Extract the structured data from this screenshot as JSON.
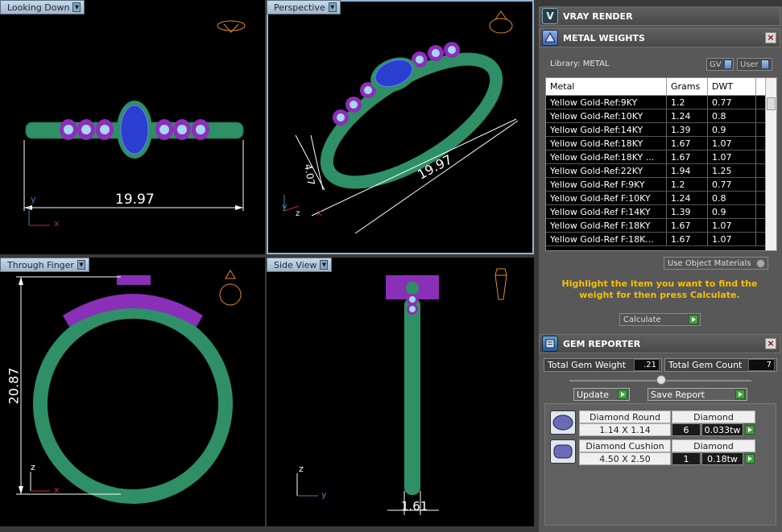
{
  "viewports": {
    "looking_down": {
      "label": "Looking Down",
      "dimension": "19.97",
      "axis_y": "y",
      "axis_x": "x"
    },
    "perspective": {
      "label": "Perspective",
      "dimension_a": "19.97",
      "dimension_b": "4.07",
      "axis_y": "y",
      "axis_z": "z",
      "axis_x": "x"
    },
    "through_finger": {
      "label": "Through Finger",
      "dimension": "20.87",
      "axis_z": "z",
      "axis_x": "x"
    },
    "side_view": {
      "label": "Side View",
      "dimension": "1.61",
      "axis_z": "z",
      "axis_y": "y"
    }
  },
  "vray_render": {
    "title": "VRAY RENDER"
  },
  "metal_weights": {
    "title": "METAL WEIGHTS",
    "library_label": "Library: METAL",
    "toggle_gv": "GV",
    "toggle_user": "User",
    "columns": [
      "Metal",
      "Grams",
      "DWT"
    ],
    "rows": [
      [
        "Yellow Gold-Ref:9KY",
        "1.2",
        "0.77"
      ],
      [
        "Yellow Gold-Ref:10KY",
        "1.24",
        "0.8"
      ],
      [
        "Yellow Gold-Ref:14KY",
        "1.39",
        "0.9"
      ],
      [
        "Yellow Gold-Ref:18KY",
        "1.67",
        "1.07"
      ],
      [
        "Yellow Gold-Ref:18KY ...",
        "1.67",
        "1.07"
      ],
      [
        "Yellow Gold-Ref:22KY",
        "1.94",
        "1.25"
      ],
      [
        "Yellow Gold-Ref F:9KY",
        "1.2",
        "0.77"
      ],
      [
        "Yellow Gold-Ref F:10KY",
        "1.24",
        "0.8"
      ],
      [
        "Yellow Gold-Ref F:14KY",
        "1.39",
        "0.9"
      ],
      [
        "Yellow Gold-Ref F:18KY",
        "1.67",
        "1.07"
      ],
      [
        "Yellow Gold-Ref F:18K...",
        "1.67",
        "1.07"
      ]
    ],
    "use_object_materials": "Use Object Materials",
    "hint": "Highlight the item you want to find the weight for then press Calculate.",
    "calculate": "Calculate"
  },
  "gem_reporter": {
    "title": "GEM REPORTER",
    "total_gem_weight_label": "Total Gem Weight",
    "total_gem_weight": ".21",
    "total_gem_count_label": "Total Gem Count",
    "total_gem_count": "7",
    "update": "Update",
    "save_report": "Save Report",
    "gems": [
      {
        "shape": "Diamond Round",
        "size": "1.14 X 1.14",
        "material": "Diamond",
        "count": "6",
        "weight": "0.033tw"
      },
      {
        "shape": "Diamond Cushion",
        "size": "4.50 X 2.50",
        "material": "Diamond",
        "count": "1",
        "weight": "0.18tw"
      }
    ]
  },
  "colors": {
    "band": "#2f8f66",
    "setting": "#8a2fb8",
    "gem": "#2a3fd0",
    "accent_text": "#f5c000",
    "dimension": "#ffffff",
    "wire_icon": "#e08a2a"
  }
}
